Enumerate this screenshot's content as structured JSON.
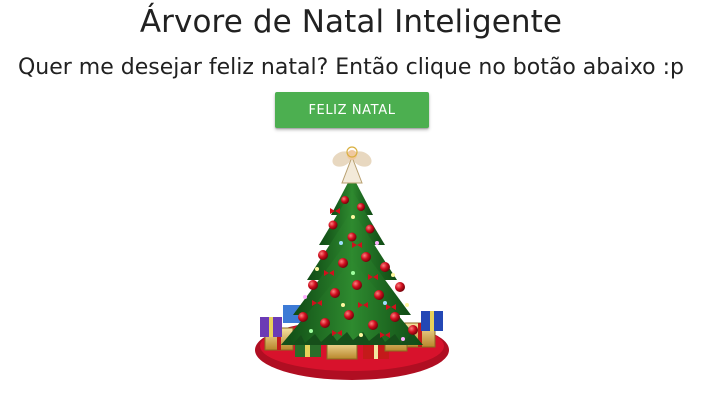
{
  "header": {
    "title": "Árvore de Natal Inteligente",
    "subtitle": "Quer me desejar feliz natal? Então clique no botão abaixo :p"
  },
  "actions": {
    "button_label": "FELIZ NATAL"
  },
  "colors": {
    "button_bg": "#4caf50",
    "button_text": "#ffffff",
    "text": "#212121",
    "tree_green": "#1f6b22",
    "skirt_red": "#c8102e"
  },
  "images": {
    "tree": "animated-christmas-tree-image"
  }
}
